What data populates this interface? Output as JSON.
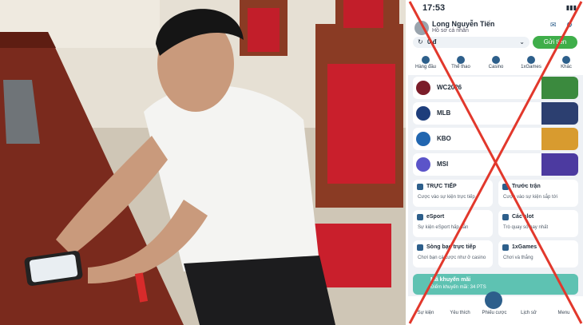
{
  "phone": {
    "status_time": "17:53",
    "user_name": "Long Nguyễn Tiến",
    "user_subtitle": "Hồ sơ cá nhân",
    "balance": "0 đ",
    "deposit_label": "Gửi tiền",
    "nav": [
      "Hàng đầu",
      "Thể thao",
      "Casino",
      "1xGames",
      "Khác"
    ],
    "leagues": [
      "WC2026",
      "MLB",
      "KBO",
      "MSI"
    ],
    "cards": [
      {
        "title": "TRỰC TIẾP",
        "subtitle": "Cược vào sự kiện trực tiếp"
      },
      {
        "title": "Trước trận",
        "subtitle": "Cược vào sự kiện sắp tới"
      },
      {
        "title": "eSport",
        "subtitle": "Sự kiện eSport hấp dẫn"
      },
      {
        "title": "Các slot",
        "subtitle": "Trò quay số hay nhất"
      },
      {
        "title": "Sòng bạc trực tiếp",
        "subtitle": "Chơi bạn cá cược như ở casino"
      },
      {
        "title": "1xGames",
        "subtitle": "Chơi và thắng"
      }
    ],
    "promo_title": "Mã khuyến mãi",
    "promo_points": "Điểm khuyến mãi: 34 PTS",
    "bottom_nav": [
      "Sự kiện",
      "Yêu thích",
      "Phiếu cược",
      "Lịch sử",
      "Menu"
    ]
  },
  "colors": {
    "cross": "#e2382c",
    "deposit": "#3fae4a",
    "promo": "#5ec2b2"
  }
}
